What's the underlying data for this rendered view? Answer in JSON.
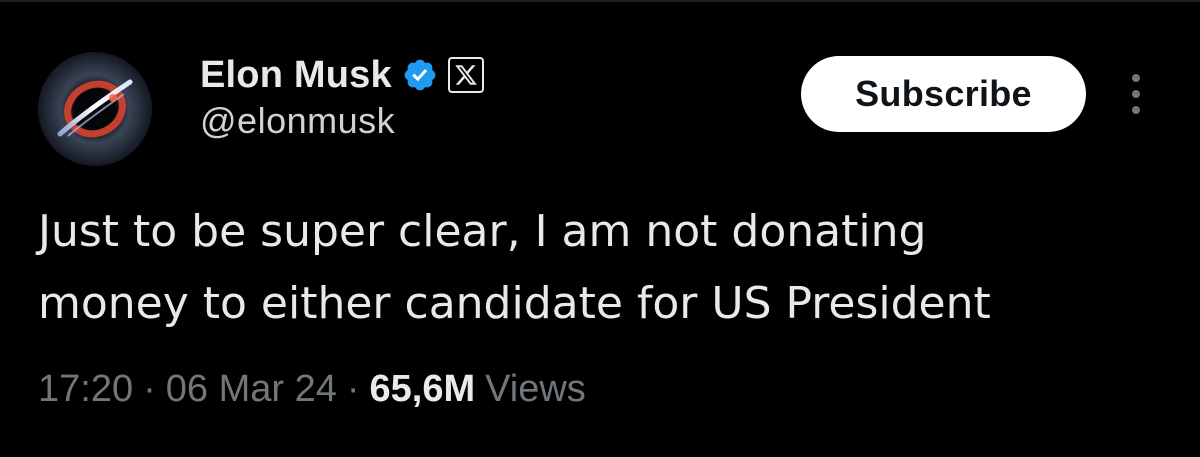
{
  "author": {
    "display_name": "Elon Musk",
    "handle": "@elonmusk",
    "verified_icon": "verified-badge-icon",
    "affiliate_icon": "x-logo-icon",
    "avatar_icon": "avatar-image"
  },
  "actions": {
    "subscribe_label": "Subscribe",
    "more_icon": "more-vertical-icon"
  },
  "tweet": {
    "lines": [
      "Just to be super clear, I am not donating",
      "money to either candidate for US President"
    ]
  },
  "meta": {
    "time": "17:20",
    "separator": "·",
    "date": "06 Mar 24",
    "views_count": "65,6M",
    "views_label": "Views"
  },
  "colors": {
    "background": "#000000",
    "text_primary": "#e7e9ea",
    "text_secondary": "#71767b",
    "verified_blue": "#1d9bf0",
    "button_bg": "#ffffff",
    "button_text": "#0f1419"
  }
}
